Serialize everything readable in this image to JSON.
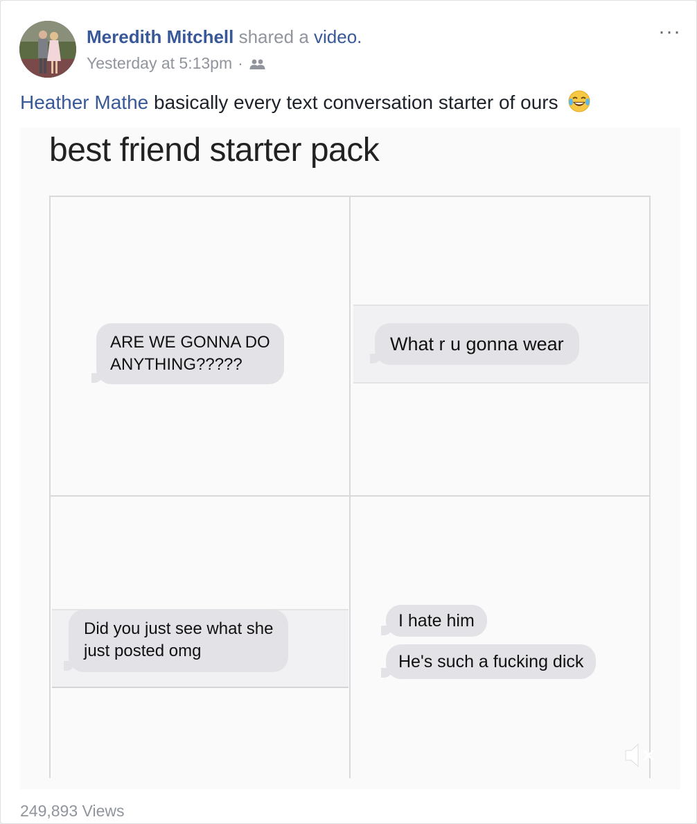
{
  "post": {
    "author": "Meredith Mitchell",
    "action": "shared a",
    "object_link": "video.",
    "timestamp": "Yesterday at 5:13pm",
    "separator": "·",
    "privacy_icon": "friends-icon",
    "more_label": "···",
    "caption": {
      "tagged_name": "Heather Mathe",
      "text": "basically every text conversation starter of ours",
      "emoji": "tears-of-joy-emoji"
    },
    "views": "249,893 Views"
  },
  "video": {
    "title": "best friend starter pack",
    "panels": [
      {
        "messages": [
          "ARE WE GONNA DO",
          "ANYTHING?????"
        ]
      },
      {
        "messages": [
          "What r u gonna wear"
        ]
      },
      {
        "messages": [
          "Did you just see what she",
          "just posted omg"
        ]
      },
      {
        "messages": [
          "I hate him",
          "He's such a fucking dick"
        ]
      }
    ],
    "mute_icon": "muted-speaker-icon"
  },
  "colors": {
    "link": "#385898",
    "meta": "#90949c",
    "bubble": "#e3e3e7"
  }
}
